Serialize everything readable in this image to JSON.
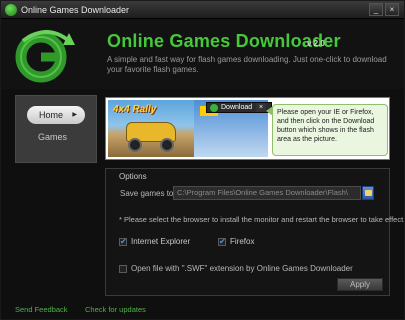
{
  "window": {
    "title": "Online Games Downloader",
    "minimize_glyph": "_",
    "close_glyph": "×"
  },
  "header": {
    "app_title": "Online Games Downloader",
    "version": "v 2.0",
    "description": "A simple and fast way for flash games downloading. Just one-click to download your favorite flash games.",
    "logo_icon": "green-g-arrow-logo-icon"
  },
  "sidebar": {
    "items": [
      {
        "label": "Home",
        "active": true
      },
      {
        "label": "Games",
        "active": false
      }
    ]
  },
  "banner": {
    "game_title": "4x4 Rally",
    "download_label": "Download",
    "close_glyph": "×",
    "tip": "Please open your IE or Firefox, and then click on the Download button which shows in the flash area as the picture."
  },
  "options": {
    "legend": "Options",
    "save_label": "Save games to:",
    "save_path": "C:\\Program Files\\Online Games Downloader\\Flash\\",
    "notice": "* Please select the browser to install the monitor and restart the browser to take effect.",
    "browsers": [
      {
        "label": "Internet Explorer",
        "checked": true
      },
      {
        "label": "Firefox",
        "checked": true
      }
    ],
    "swf_label": "Open file with \".SWF\" extension by Online Games Downloader",
    "swf_checked": false,
    "apply_label": "Apply"
  },
  "footer": {
    "feedback_label": "Send Feedback",
    "updates_label": "Check for updates"
  },
  "colors": {
    "accent_green": "#45c83a",
    "link_green": "#4fb34a",
    "background": "#0f0f0f"
  }
}
